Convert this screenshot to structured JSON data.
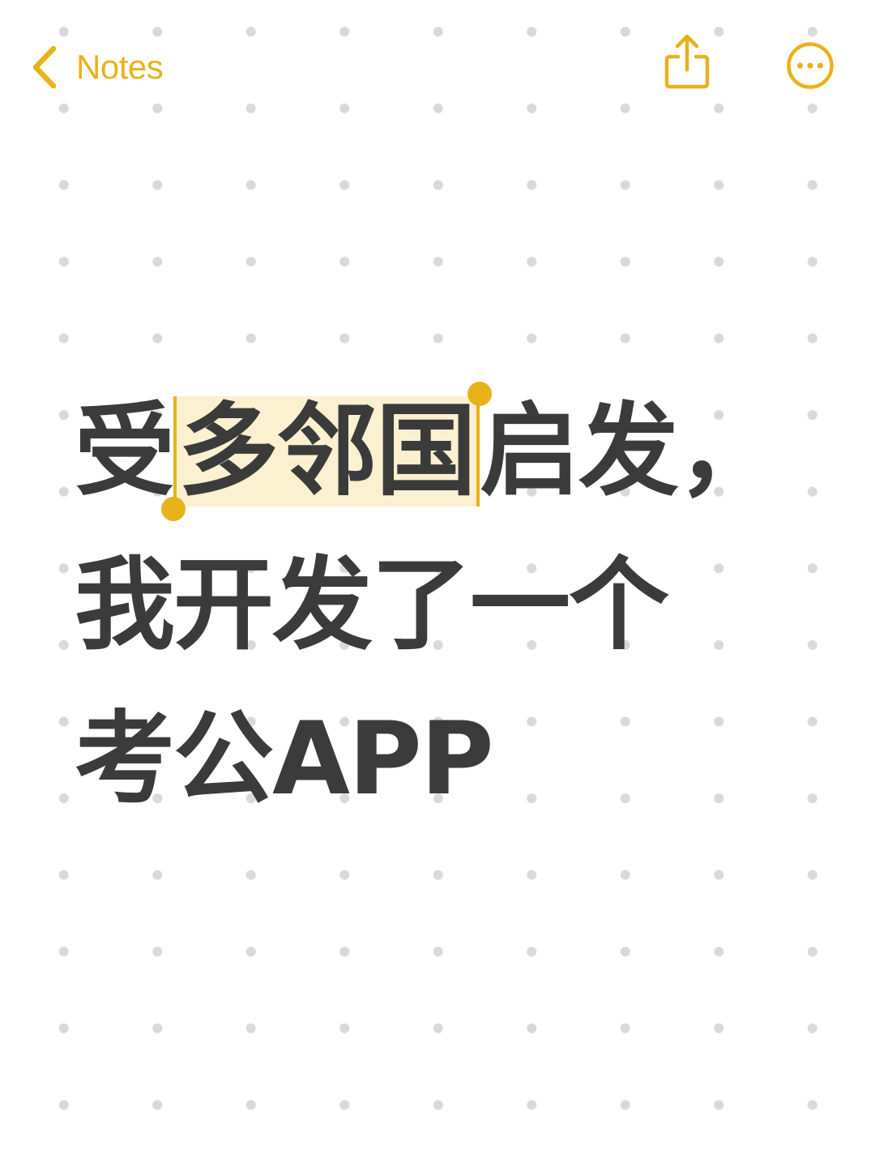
{
  "nav": {
    "back_label": "Notes",
    "back_icon": "chevron-left-icon",
    "share_icon": "share-icon",
    "more_icon": "ellipsis-circle-icon"
  },
  "note": {
    "line1": {
      "before": "受",
      "selected": "多邻国",
      "after": "启发，"
    },
    "line2": "我开发了一个",
    "line3": "考公APP"
  },
  "colors": {
    "accent": "#E8B21A",
    "text": "#3B3B3B",
    "selection_bg": "#FBF0CF",
    "grid_dot": "#D9D9D9",
    "background": "#FFFFFF"
  }
}
